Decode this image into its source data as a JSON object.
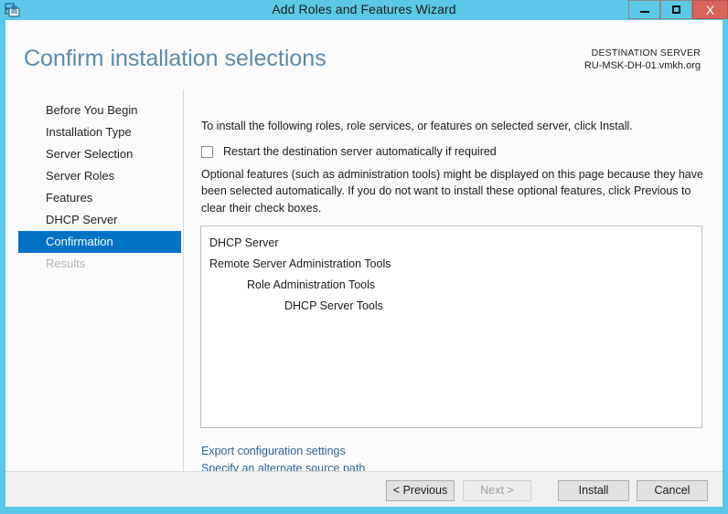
{
  "window": {
    "title": "Add Roles and Features Wizard",
    "icon": "wizard-server-icon",
    "controls": {
      "minimize": "minimize-icon",
      "maximize": "maximize-icon",
      "close": "X"
    },
    "accent_color": "#5bc8e8",
    "close_color": "#d96459"
  },
  "header": {
    "page_title": "Confirm installation selections",
    "destination_label": "DESTINATION SERVER",
    "destination_server": "RU-MSK-DH-01.vmkh.org",
    "title_color": "#5a8baa"
  },
  "sidebar": {
    "selected_color": "#0072c6",
    "items": [
      {
        "label": "Before You Begin",
        "state": "normal"
      },
      {
        "label": "Installation Type",
        "state": "normal"
      },
      {
        "label": "Server Selection",
        "state": "normal"
      },
      {
        "label": "Server Roles",
        "state": "normal"
      },
      {
        "label": "Features",
        "state": "normal"
      },
      {
        "label": "DHCP Server",
        "state": "normal"
      },
      {
        "label": "Confirmation",
        "state": "selected"
      },
      {
        "label": "Results",
        "state": "disabled"
      }
    ]
  },
  "content": {
    "intro_text": "To install the following roles, role services, or features on selected server, click Install.",
    "restart_checkbox": {
      "label": "Restart the destination server automatically if required",
      "checked": false
    },
    "optional_text": "Optional features (such as administration tools) might be displayed on this page because they have been selected automatically. If you do not want to install these optional features, click Previous to clear their check boxes.",
    "selections": [
      {
        "label": "DHCP Server",
        "indent": 0
      },
      {
        "label": "Remote Server Administration Tools",
        "indent": 0
      },
      {
        "label": "Role Administration Tools",
        "indent": 1
      },
      {
        "label": "DHCP Server Tools",
        "indent": 2
      }
    ],
    "links": [
      {
        "label": "Export configuration settings"
      },
      {
        "label": "Specify an alternate source path"
      }
    ],
    "link_color": "#2a6496"
  },
  "footer": {
    "buttons": [
      {
        "label": "< Previous",
        "state": "normal"
      },
      {
        "label": "Next >",
        "state": "disabled"
      },
      {
        "label": "Install",
        "state": "normal"
      },
      {
        "label": "Cancel",
        "state": "normal"
      }
    ]
  }
}
